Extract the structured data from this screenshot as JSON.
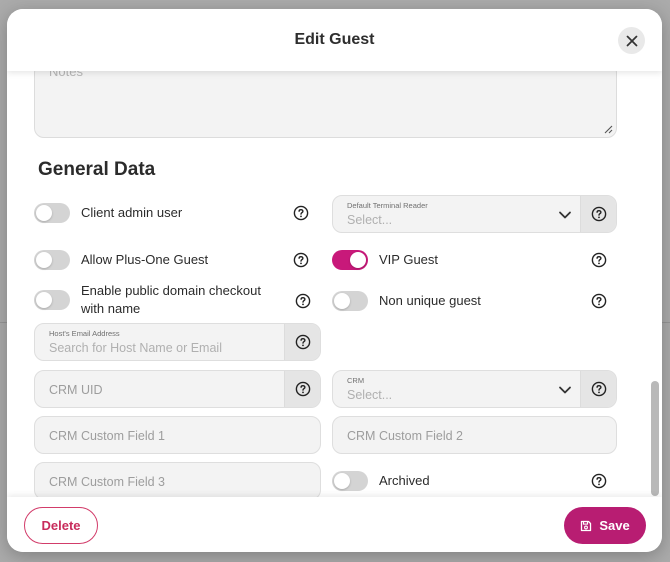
{
  "dialog": {
    "title": "Edit Guest"
  },
  "notes": {
    "placeholder": "Notes"
  },
  "general_data": {
    "title": "General Data",
    "client_admin_user": {
      "label": "Client admin user",
      "on": false
    },
    "allow_plus_one": {
      "label": "Allow Plus-One Guest",
      "on": false
    },
    "public_checkout": {
      "label": "Enable public domain checkout with name",
      "on": false
    },
    "vip_guest": {
      "label": "VIP Guest",
      "on": true
    },
    "non_unique_guest": {
      "label": "Non unique guest",
      "on": false
    },
    "archived": {
      "label": "Archived",
      "on": false
    },
    "terminal_reader": {
      "label": "Default Terminal Reader",
      "placeholder": "Select..."
    },
    "host_email": {
      "label": "Host's Email Address",
      "placeholder": "Search for Host Name or Email"
    },
    "crm_uid": {
      "placeholder": "CRM UID"
    },
    "crm": {
      "label": "CRM",
      "placeholder": "Select..."
    },
    "crm_custom_1": {
      "placeholder": "CRM Custom Field 1"
    },
    "crm_custom_2": {
      "placeholder": "CRM Custom Field 2"
    },
    "crm_custom_3": {
      "placeholder": "CRM Custom Field 3"
    }
  },
  "footer": {
    "delete_label": "Delete",
    "save_label": "Save"
  },
  "colors": {
    "accent": "#c8197a",
    "delete": "#c82c5c",
    "save": "#b81d72"
  },
  "icons": {
    "close": "close-icon",
    "help": "question-circle-icon",
    "chevron": "chevron-down-icon",
    "save": "floppy-disk-icon",
    "resize": "resize-grip-icon"
  }
}
